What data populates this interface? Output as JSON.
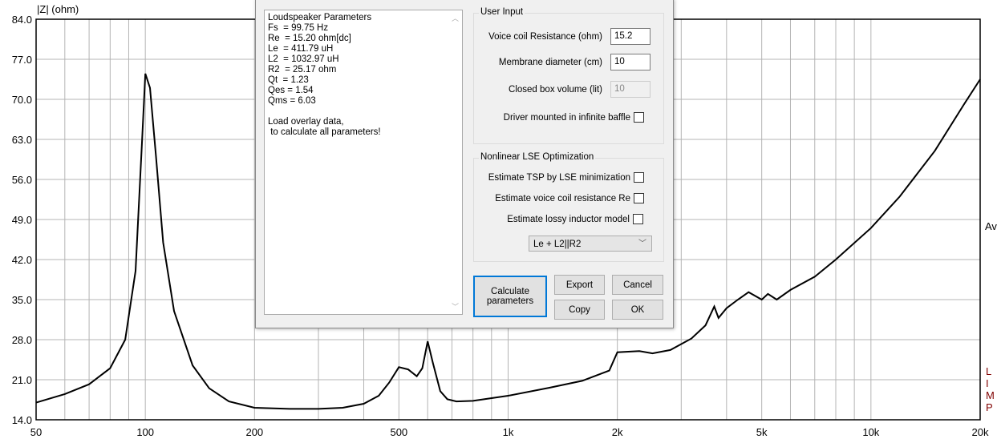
{
  "chart_data": {
    "type": "line",
    "ylabel": "|Z| (ohm)",
    "xscale": "log",
    "xlim": [
      50,
      20000
    ],
    "ylim": [
      14,
      84
    ],
    "grid": true,
    "yticks": [
      "84.0",
      "77.0",
      "70.0",
      "63.0",
      "56.0",
      "49.0",
      "42.0",
      "35.0",
      "28.0",
      "21.0",
      "14.0"
    ],
    "xticks": [
      {
        "v": 50,
        "label": "50"
      },
      {
        "v": 100,
        "label": "100"
      },
      {
        "v": 200,
        "label": "200"
      },
      {
        "v": 500,
        "label": "500"
      },
      {
        "v": 1000,
        "label": "1k"
      },
      {
        "v": 2000,
        "label": "2k"
      },
      {
        "v": 5000,
        "label": "5k"
      },
      {
        "v": 10000,
        "label": "10k"
      },
      {
        "v": 20000,
        "label": "20k"
      }
    ],
    "series": [
      {
        "color": "#000000",
        "x": [
          50,
          60,
          70,
          80,
          88,
          94,
          98,
          100,
          103,
          107,
          112,
          120,
          135,
          150,
          170,
          200,
          250,
          300,
          350,
          400,
          440,
          470,
          500,
          530,
          560,
          580,
          600,
          620,
          650,
          680,
          720,
          800,
          1000,
          1300,
          1600,
          1900,
          2000,
          2300,
          2500,
          2800,
          3200,
          3500,
          3700,
          3800,
          4000,
          4300,
          4600,
          5000,
          5200,
          5500,
          6000,
          7000,
          8000,
          10000,
          12000,
          15000,
          18000,
          20000
        ],
        "y": [
          17,
          18.5,
          20.2,
          23,
          28,
          40,
          63,
          74.5,
          72,
          60,
          45,
          33,
          23.5,
          19.5,
          17.2,
          16.1,
          15.9,
          15.9,
          16.1,
          16.8,
          18.2,
          20.5,
          23.2,
          22.8,
          21.6,
          23,
          27.7,
          24,
          19,
          17.6,
          17.2,
          17.3,
          18.2,
          19.6,
          20.8,
          22.6,
          25.8,
          26,
          25.6,
          26.2,
          28.2,
          30.5,
          33.8,
          31.8,
          33.5,
          35,
          36.3,
          35,
          36,
          35,
          36.7,
          39,
          42,
          47.5,
          53,
          61,
          69,
          73.5
        ]
      }
    ]
  },
  "right_labels": {
    "avg": "Av",
    "limp": "LIMP"
  },
  "dialog": {
    "params_text": "Loudspeaker Parameters\nFs  = 99.75 Hz\nRe  = 15.20 ohm[dc]\nLe  = 411.79 uH\nL2  = 1032.97 uH\nR2  = 25.17 ohm\nQt  = 1.23\nQes = 1.54\nQms = 6.03\n\nLoad overlay data,\n to calculate all parameters!",
    "user_input": {
      "title": "User Input",
      "voice_coil_label": "Voice coil Resistance (ohm)",
      "voice_coil_value": "15.2",
      "membrane_label": "Membrane diameter (cm)",
      "membrane_value": "10",
      "box_label": "Closed box volume (lit)",
      "box_value": "10",
      "baffle_label": "Driver mounted in infinite baffle"
    },
    "lse": {
      "title": "Nonlinear LSE Optimization",
      "tsp_label": "Estimate TSP by LSE minimization",
      "re_label": "Estimate voice coil resistance Re",
      "lossy_label": "Estimate lossy inductor model",
      "model_selected": "Le + L2||R2"
    },
    "buttons": {
      "calculate": "Calculate parameters",
      "export": "Export",
      "cancel": "Cancel",
      "copy": "Copy",
      "ok": "OK"
    }
  }
}
